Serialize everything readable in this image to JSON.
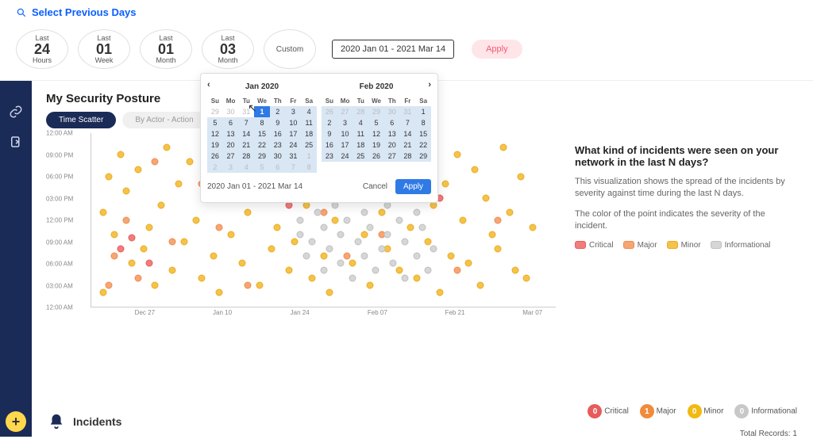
{
  "header": {
    "title": "Select Previous Days",
    "chips": [
      {
        "top": "Last",
        "big": "24",
        "bottom": "Hours"
      },
      {
        "top": "Last",
        "big": "01",
        "bottom": "Week"
      },
      {
        "top": "Last",
        "big": "01",
        "bottom": "Month"
      },
      {
        "top": "Last",
        "big": "03",
        "bottom": "Month"
      }
    ],
    "custom_label": "Custom",
    "range_text": "2020 Jan 01 - 2021 Mar 14",
    "apply_label": "Apply"
  },
  "calendar": {
    "months": [
      "Jan 2020",
      "Feb 2020"
    ],
    "dow": [
      "Su",
      "Mo",
      "Tu",
      "We",
      "Th",
      "Fr",
      "Sa"
    ],
    "jan": [
      [
        {
          "d": "29",
          "dim": 1
        },
        {
          "d": "30",
          "dim": 1
        },
        {
          "d": "31",
          "dim": 1
        },
        {
          "d": "1",
          "sel": 1
        },
        {
          "d": "2",
          "inr": 1
        },
        {
          "d": "3",
          "inr": 1
        },
        {
          "d": "4",
          "inr": 1
        }
      ],
      [
        {
          "d": "5",
          "inr": 1
        },
        {
          "d": "6",
          "inr": 1
        },
        {
          "d": "7",
          "inr": 1
        },
        {
          "d": "8",
          "inr": 1
        },
        {
          "d": "9",
          "inr": 1
        },
        {
          "d": "10",
          "inr": 1
        },
        {
          "d": "11",
          "inr": 1
        }
      ],
      [
        {
          "d": "12",
          "inr": 1
        },
        {
          "d": "13",
          "inr": 1
        },
        {
          "d": "14",
          "inr": 1
        },
        {
          "d": "15",
          "inr": 1
        },
        {
          "d": "16",
          "inr": 1
        },
        {
          "d": "17",
          "inr": 1
        },
        {
          "d": "18",
          "inr": 1
        }
      ],
      [
        {
          "d": "19",
          "inr": 1
        },
        {
          "d": "20",
          "inr": 1
        },
        {
          "d": "21",
          "inr": 1
        },
        {
          "d": "22",
          "inr": 1
        },
        {
          "d": "23",
          "inr": 1
        },
        {
          "d": "24",
          "inr": 1
        },
        {
          "d": "25",
          "inr": 1
        }
      ],
      [
        {
          "d": "26",
          "inr": 1
        },
        {
          "d": "27",
          "inr": 1
        },
        {
          "d": "28",
          "inr": 1
        },
        {
          "d": "29",
          "inr": 1
        },
        {
          "d": "30",
          "inr": 1
        },
        {
          "d": "31",
          "inr": 1
        },
        {
          "d": "1",
          "dim": 1,
          "inr": 1
        }
      ],
      [
        {
          "d": "2",
          "dim": 1,
          "inr": 1
        },
        {
          "d": "3",
          "dim": 1,
          "inr": 1
        },
        {
          "d": "4",
          "dim": 1,
          "inr": 1
        },
        {
          "d": "5",
          "dim": 1,
          "inr": 1
        },
        {
          "d": "6",
          "dim": 1,
          "inr": 1
        },
        {
          "d": "7",
          "dim": 1,
          "inr": 1
        },
        {
          "d": "8",
          "dim": 1,
          "inr": 1
        }
      ]
    ],
    "feb": [
      [
        {
          "d": "26",
          "dim": 1,
          "inr": 1
        },
        {
          "d": "27",
          "dim": 1,
          "inr": 1
        },
        {
          "d": "28",
          "dim": 1,
          "inr": 1
        },
        {
          "d": "29",
          "dim": 1,
          "inr": 1
        },
        {
          "d": "30",
          "dim": 1,
          "inr": 1
        },
        {
          "d": "31",
          "dim": 1,
          "inr": 1
        },
        {
          "d": "1",
          "inr": 1
        }
      ],
      [
        {
          "d": "2",
          "inr": 1
        },
        {
          "d": "3",
          "inr": 1
        },
        {
          "d": "4",
          "inr": 1
        },
        {
          "d": "5",
          "inr": 1
        },
        {
          "d": "6",
          "inr": 1
        },
        {
          "d": "7",
          "inr": 1
        },
        {
          "d": "8",
          "inr": 1
        }
      ],
      [
        {
          "d": "9",
          "inr": 1
        },
        {
          "d": "10",
          "inr": 1
        },
        {
          "d": "11",
          "inr": 1
        },
        {
          "d": "12",
          "inr": 1
        },
        {
          "d": "13",
          "inr": 1
        },
        {
          "d": "14",
          "inr": 1
        },
        {
          "d": "15",
          "inr": 1
        }
      ],
      [
        {
          "d": "16",
          "inr": 1
        },
        {
          "d": "17",
          "inr": 1
        },
        {
          "d": "18",
          "inr": 1
        },
        {
          "d": "19",
          "inr": 1
        },
        {
          "d": "20",
          "inr": 1
        },
        {
          "d": "21",
          "inr": 1
        },
        {
          "d": "22",
          "inr": 1
        }
      ],
      [
        {
          "d": "23",
          "inr": 1
        },
        {
          "d": "24",
          "inr": 1
        },
        {
          "d": "25",
          "inr": 1
        },
        {
          "d": "26",
          "inr": 1
        },
        {
          "d": "27",
          "inr": 1
        },
        {
          "d": "28",
          "inr": 1
        },
        {
          "d": "29",
          "inr": 1
        }
      ]
    ],
    "footer_range": "2020 Jan 01 - 2021 Mar 14",
    "cancel": "Cancel",
    "apply": "Apply"
  },
  "posture": {
    "title": "My Security Posture",
    "tabs": {
      "scatter": "Time Scatter",
      "actor": "By Actor - Action"
    }
  },
  "side_panel": {
    "question": "What kind of incidents were seen on your network in the last N days?",
    "desc1": "This visualization shows the spread of the incidents by severity against time during the last N days.",
    "desc2": "The color of the point indicates the severity of the incident.",
    "legend": {
      "critical": "Critical",
      "major": "Major",
      "minor": "Minor",
      "info": "Informational"
    }
  },
  "incidents": {
    "title": "Incidents",
    "counts": {
      "critical": "0",
      "major": "1",
      "minor": "0",
      "info": "0"
    },
    "labels": {
      "critical": "Critical",
      "major": "Major",
      "minor": "Minor",
      "info": "Informational"
    },
    "total": "Total Records: 1"
  },
  "chart_data": {
    "type": "scatter",
    "title": "Time Scatter",
    "xlabel": "",
    "ylabel": "",
    "x_ticks": [
      "Dec 27",
      "Jan 10",
      "Jan 24",
      "Feb 07",
      "Feb 21",
      "Mar 07"
    ],
    "y_ticks": [
      "12:00 AM",
      "03:00 AM",
      "06:00 AM",
      "09:00 AM",
      "12:00 PM",
      "03:00 PM",
      "06:00 PM",
      "09:00 PM",
      "12:00 AM"
    ],
    "xlim": [
      0,
      80
    ],
    "ylim": [
      0,
      24
    ],
    "series": [
      {
        "name": "Critical",
        "color": "#e85b5b",
        "points": [
          [
            5,
            8
          ],
          [
            7,
            9.5
          ],
          [
            10,
            6
          ],
          [
            34,
            14
          ],
          [
            35,
            16
          ],
          [
            60,
            15
          ]
        ]
      },
      {
        "name": "Major",
        "color": "#ee8c50",
        "points": [
          [
            3,
            3
          ],
          [
            4,
            7
          ],
          [
            6,
            12
          ],
          [
            8,
            4
          ],
          [
            11,
            20
          ],
          [
            14,
            9
          ],
          [
            19,
            17
          ],
          [
            22,
            11
          ],
          [
            27,
            3
          ],
          [
            31,
            19
          ],
          [
            40,
            13
          ],
          [
            44,
            7
          ],
          [
            50,
            10
          ],
          [
            56,
            18
          ],
          [
            63,
            5
          ],
          [
            70,
            12
          ]
        ]
      },
      {
        "name": "Minor",
        "color": "#e9ad20",
        "points": [
          [
            2,
            2
          ],
          [
            2,
            13
          ],
          [
            3,
            18
          ],
          [
            4,
            10
          ],
          [
            5,
            21
          ],
          [
            6,
            16
          ],
          [
            7,
            6
          ],
          [
            8,
            19
          ],
          [
            9,
            8
          ],
          [
            10,
            11
          ],
          [
            11,
            3
          ],
          [
            12,
            14
          ],
          [
            13,
            22
          ],
          [
            14,
            5
          ],
          [
            15,
            17
          ],
          [
            16,
            9
          ],
          [
            17,
            20
          ],
          [
            18,
            12
          ],
          [
            19,
            4
          ],
          [
            20,
            15
          ],
          [
            21,
            7
          ],
          [
            22,
            2
          ],
          [
            23,
            21
          ],
          [
            24,
            10
          ],
          [
            25,
            18
          ],
          [
            26,
            6
          ],
          [
            27,
            13
          ],
          [
            28,
            19
          ],
          [
            29,
            3
          ],
          [
            30,
            16
          ],
          [
            31,
            8
          ],
          [
            32,
            11
          ],
          [
            33,
            22
          ],
          [
            34,
            5
          ],
          [
            35,
            9
          ],
          [
            36,
            20
          ],
          [
            37,
            14
          ],
          [
            38,
            4
          ],
          [
            39,
            17
          ],
          [
            40,
            7
          ],
          [
            41,
            2
          ],
          [
            42,
            12
          ],
          [
            43,
            19
          ],
          [
            44,
            15
          ],
          [
            45,
            6
          ],
          [
            46,
            21
          ],
          [
            47,
            10
          ],
          [
            48,
            3
          ],
          [
            49,
            18
          ],
          [
            50,
            13
          ],
          [
            51,
            8
          ],
          [
            52,
            22
          ],
          [
            53,
            5
          ],
          [
            54,
            16
          ],
          [
            55,
            11
          ],
          [
            56,
            4
          ],
          [
            57,
            20
          ],
          [
            58,
            9
          ],
          [
            59,
            14
          ],
          [
            60,
            2
          ],
          [
            61,
            17
          ],
          [
            62,
            7
          ],
          [
            63,
            21
          ],
          [
            64,
            12
          ],
          [
            65,
            6
          ],
          [
            66,
            19
          ],
          [
            67,
            3
          ],
          [
            68,
            15
          ],
          [
            69,
            10
          ],
          [
            70,
            8
          ],
          [
            71,
            22
          ],
          [
            72,
            13
          ],
          [
            73,
            5
          ],
          [
            74,
            18
          ],
          [
            75,
            4
          ],
          [
            76,
            11
          ]
        ]
      },
      {
        "name": "Informational",
        "color": "#bfbfbf",
        "points": [
          [
            36,
            10
          ],
          [
            36,
            12
          ],
          [
            37,
            7
          ],
          [
            37,
            15
          ],
          [
            38,
            18
          ],
          [
            38,
            9
          ],
          [
            39,
            13
          ],
          [
            39,
            20
          ],
          [
            40,
            5
          ],
          [
            40,
            11
          ],
          [
            41,
            16
          ],
          [
            41,
            8
          ],
          [
            42,
            14
          ],
          [
            42,
            21
          ],
          [
            43,
            6
          ],
          [
            43,
            10
          ],
          [
            44,
            17
          ],
          [
            44,
            12
          ],
          [
            45,
            4
          ],
          [
            45,
            19
          ],
          [
            46,
            9
          ],
          [
            46,
            15
          ],
          [
            47,
            13
          ],
          [
            47,
            7
          ],
          [
            48,
            20
          ],
          [
            48,
            11
          ],
          [
            49,
            5
          ],
          [
            49,
            16
          ],
          [
            50,
            8
          ],
          [
            50,
            18
          ],
          [
            51,
            14
          ],
          [
            51,
            10
          ],
          [
            52,
            6
          ],
          [
            52,
            21
          ],
          [
            53,
            12
          ],
          [
            53,
            17
          ],
          [
            54,
            9
          ],
          [
            54,
            4
          ],
          [
            55,
            15
          ],
          [
            55,
            19
          ],
          [
            56,
            7
          ],
          [
            56,
            13
          ],
          [
            57,
            11
          ],
          [
            57,
            20
          ],
          [
            58,
            5
          ],
          [
            58,
            16
          ],
          [
            59,
            8
          ]
        ]
      }
    ]
  }
}
